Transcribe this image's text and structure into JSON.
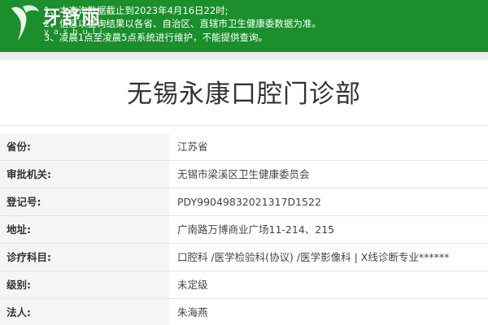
{
  "notice": {
    "lines": [
      "1、本查询数据截止到2023年4月16日22时;",
      "2、信息以查询结果以各省、自治区、直辖市卫生健康委数据为准。",
      "3、凌晨1点至凌晨5点系统进行维护，不能提供查询。"
    ],
    "background_color": "#1a8f2c"
  },
  "watermark": {
    "text": "牙舒丽",
    "sub": "yashuli"
  },
  "title": "无锡永康口腔门诊部",
  "rows": [
    {
      "label": "省份:",
      "value": "江苏省"
    },
    {
      "label": "审批机关:",
      "value": "无锡市梁溪区卫生健康委员会"
    },
    {
      "label": "登记号:",
      "value": "PDY99049832021317D1522"
    },
    {
      "label": "地址:",
      "value": "广南路万博商业广场11-214、215"
    },
    {
      "label": "诊疗科目:",
      "value": "口腔科 /医学检验科(协议) /医学影像科  |  X线诊断专业******"
    },
    {
      "label": "级别:",
      "value": "未定级"
    },
    {
      "label": "法人:",
      "value": "朱海燕"
    }
  ]
}
